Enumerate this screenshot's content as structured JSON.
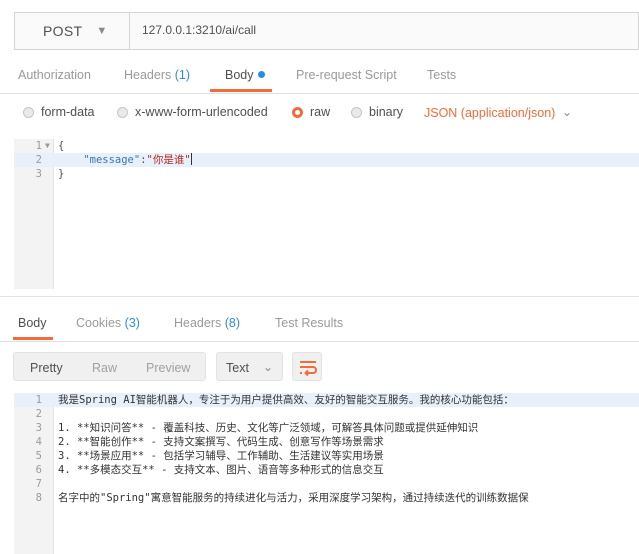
{
  "request": {
    "method": "POST",
    "url": "127.0.0.1:3210/ai/call"
  },
  "request_tabs": {
    "authorization": "Authorization",
    "headers": "Headers",
    "headers_count": "(1)",
    "body": "Body",
    "prerequest": "Pre-request Script",
    "tests": "Tests"
  },
  "body_types": {
    "form_data": "form-data",
    "urlencoded": "x-www-form-urlencoded",
    "raw": "raw",
    "binary": "binary",
    "selected": "raw",
    "content_type": "JSON (application/json)"
  },
  "request_body": {
    "line_numbers": [
      "1",
      "2",
      "3"
    ],
    "open_brace": "{",
    "key": "\"message\"",
    "colon": ":",
    "value": "\"你是谁\"",
    "close_brace": "}"
  },
  "response_tabs": {
    "body": "Body",
    "cookies": "Cookies",
    "cookies_count": "(3)",
    "headers": "Headers",
    "headers_count": "(8)",
    "test_results": "Test Results"
  },
  "response_toolbar": {
    "pretty": "Pretty",
    "raw": "Raw",
    "preview": "Preview",
    "format": "Text"
  },
  "response_body": {
    "lines": [
      {
        "n": "1",
        "text": "我是Spring AI智能机器人，专注于为用户提供高效、友好的智能交互服务。我的核心功能包括："
      },
      {
        "n": "2",
        "text": ""
      },
      {
        "n": "3",
        "text": "1. **知识问答** - 覆盖科技、历史、文化等广泛领域，可解答具体问题或提供延伸知识"
      },
      {
        "n": "4",
        "text": "2. **智能创作** - 支持文案撰写、代码生成、创意写作等场景需求"
      },
      {
        "n": "5",
        "text": "3. **场景应用** - 包括学习辅导、工作辅助、生活建议等实用场景"
      },
      {
        "n": "6",
        "text": "4. **多模态交互** - 支持文本、图片、语音等多种形式的信息交互"
      },
      {
        "n": "7",
        "text": ""
      },
      {
        "n": "8",
        "text": "名字中的\"Spring\"寓意智能服务的持续进化与活力，采用深度学习架构，通过持续迭代的训练数据保"
      }
    ]
  },
  "colors": {
    "accent": "#f26b3a",
    "link": "#2f8ae3",
    "active_line": "#e8f1fb"
  },
  "icons": {
    "method_dropdown": "chevron-down-icon",
    "content_type_dropdown": "chevron-down-icon",
    "format_dropdown": "chevron-down-icon",
    "wrap": "wrap-lines-icon",
    "fold": "fold-arrow-icon"
  }
}
